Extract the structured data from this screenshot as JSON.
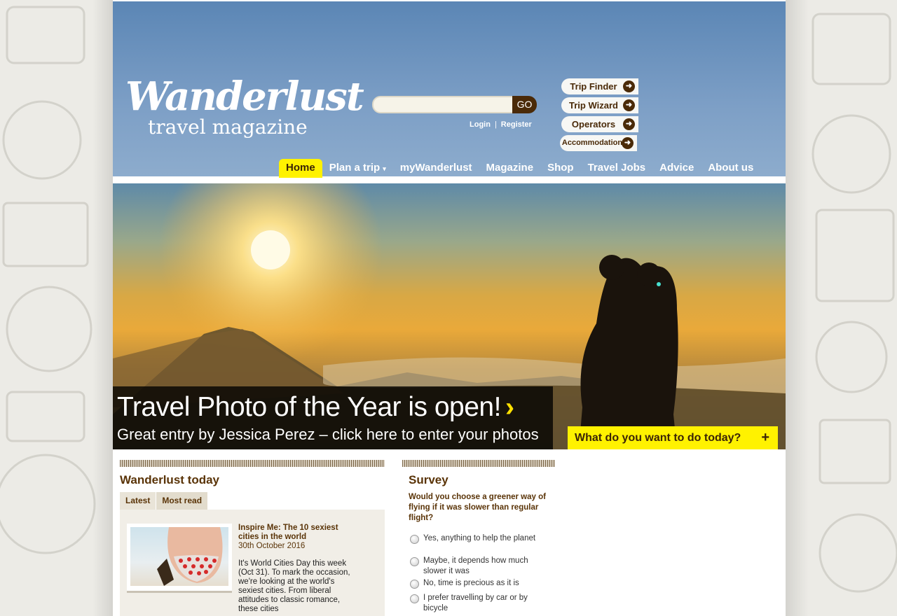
{
  "header": {
    "logo_top": "Wanderlust",
    "logo_bottom": "travel magazine",
    "search": {
      "placeholder": "",
      "go_label": "GO"
    },
    "login_label": "Login",
    "separator": "|",
    "register_label": "Register",
    "side_buttons": [
      {
        "label": "Trip Finder"
      },
      {
        "label": "Trip Wizard"
      },
      {
        "label": "Operators"
      },
      {
        "label": "Accommodation"
      }
    ]
  },
  "nav": {
    "items": [
      {
        "label": "Home",
        "active": true
      },
      {
        "label": "Plan a trip",
        "caret": "▾"
      },
      {
        "label": "myWanderlust"
      },
      {
        "label": "Magazine"
      },
      {
        "label": "Shop"
      },
      {
        "label": "Travel Jobs"
      },
      {
        "label": "Advice"
      },
      {
        "label": "About us"
      }
    ]
  },
  "hero": {
    "title": "Travel Photo of the Year is open!",
    "chevron": "›",
    "subtitle": "Great entry by Jessica Perez – click here to enter your photos",
    "todo_label": "What do you want to do today?",
    "todo_plus": "+"
  },
  "today": {
    "title": "Wanderlust today",
    "tabs": [
      {
        "label": "Latest"
      },
      {
        "label": "Most read"
      }
    ],
    "article": {
      "title": "Inspire Me: The 10 sexiest cities in the world",
      "date": "30th October 2016",
      "excerpt": "It's World Cities Day this week (Oct 31). To mark the occasion, we're looking at the world's sexiest cities. From liberal attitudes to classic romance, these cities"
    }
  },
  "survey": {
    "title": "Survey",
    "question": "Would you choose a greener way of flying if it was slower than regular flight?",
    "options": [
      {
        "label": "Yes, anything to help the planet"
      },
      {
        "label": "Maybe, it depends how much slower it was"
      },
      {
        "label": "No, time is precious as it is"
      },
      {
        "label": "I prefer travelling by car or by bicycle"
      }
    ]
  },
  "colors": {
    "header_blue": "#5b86b5",
    "accent_yellow": "#fff200",
    "brown": "#5a3408"
  }
}
